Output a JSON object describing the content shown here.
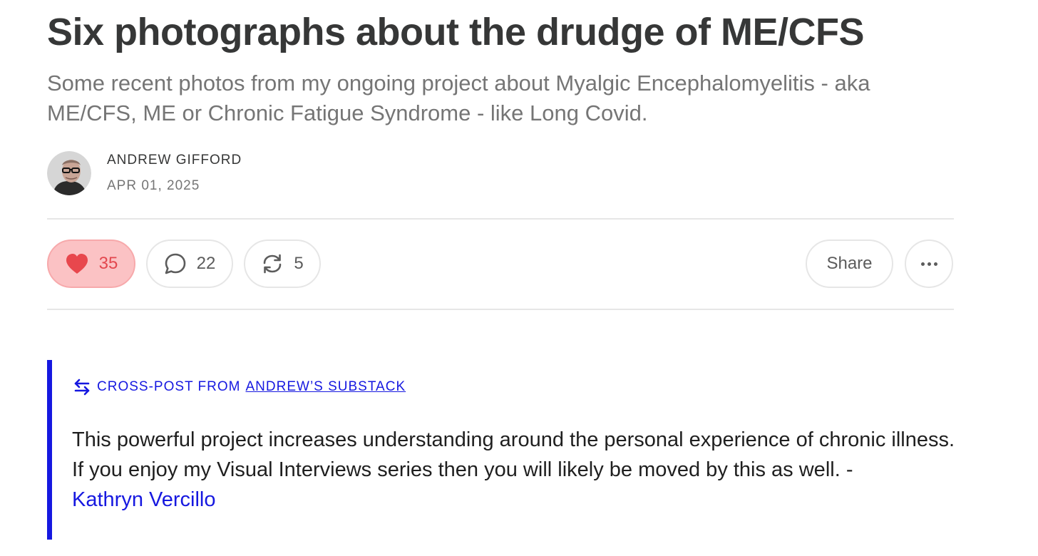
{
  "post": {
    "title": "Six photographs about the drudge of ME/CFS",
    "subtitle": "Some recent photos from my ongoing project about Myalgic Encephalomyelitis - aka ME/CFS, ME or Chronic Fatigue Syndrome - like Long Covid."
  },
  "byline": {
    "author": "ANDREW GIFFORD",
    "date": "APR 01, 2025"
  },
  "actions": {
    "likes": "35",
    "comments": "22",
    "restacks": "5",
    "share_label": "Share",
    "like_icon": "heart-icon",
    "comment_icon": "comment-icon",
    "restack_icon": "restack-icon",
    "more_icon": "more-dots-icon"
  },
  "crosspost": {
    "label": "CROSS-POST FROM",
    "source": "ANDREW’S SUBSTACK",
    "icon": "crosspost-arrows-icon"
  },
  "note": {
    "text": "This powerful project increases understanding around the personal experience of chronic illness. If you enjoy my Visual Interviews series then you will likely be moved by this as well. -",
    "author": "Kathryn Vercillo"
  },
  "colors": {
    "text": "#363737",
    "muted": "#757575",
    "like_bg": "#fbc2c4",
    "like_fg": "#e3474e",
    "accent": "#1618e0",
    "divider": "#e6e6e6"
  }
}
